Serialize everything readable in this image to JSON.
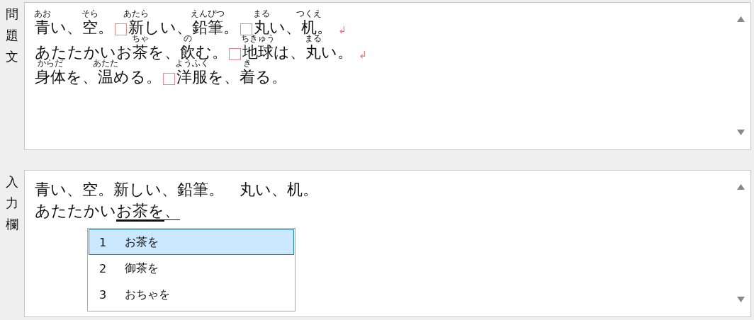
{
  "problem": {
    "label": "問題文",
    "lines": [
      [
        {
          "kind": "ruby",
          "base": "青",
          "ruby": "あお"
        },
        {
          "kind": "text",
          "text": "い、"
        },
        {
          "kind": "ruby",
          "base": "空",
          "ruby": "そら"
        },
        {
          "kind": "text",
          "text": "。"
        },
        {
          "kind": "blank"
        },
        {
          "kind": "ruby",
          "base": "新",
          "ruby": "あたら"
        },
        {
          "kind": "text",
          "text": "しい、"
        },
        {
          "kind": "ruby",
          "base": "鉛筆",
          "ruby": "えんぴつ"
        },
        {
          "kind": "text",
          "text": "。"
        },
        {
          "kind": "blank"
        },
        {
          "kind": "ruby",
          "base": "丸",
          "ruby": "まる"
        },
        {
          "kind": "text",
          "text": "い、"
        },
        {
          "kind": "ruby",
          "base": "机",
          "ruby": "つくえ"
        },
        {
          "kind": "text",
          "text": "。"
        },
        {
          "kind": "return",
          "text": "↲"
        }
      ],
      [
        {
          "kind": "text",
          "text": "あたたかいお"
        },
        {
          "kind": "ruby",
          "base": "茶",
          "ruby": "ちゃ"
        },
        {
          "kind": "text",
          "text": "を、"
        },
        {
          "kind": "ruby",
          "base": "飲",
          "ruby": "の"
        },
        {
          "kind": "text",
          "text": "む。"
        },
        {
          "kind": "blank"
        },
        {
          "kind": "ruby",
          "base": "地球",
          "ruby": "ちきゅう"
        },
        {
          "kind": "text",
          "text": "は、"
        },
        {
          "kind": "ruby",
          "base": "丸",
          "ruby": "まる"
        },
        {
          "kind": "text",
          "text": "い。"
        },
        {
          "kind": "return",
          "text": "↲"
        }
      ],
      [
        {
          "kind": "ruby",
          "base": "身体",
          "ruby": "からだ"
        },
        {
          "kind": "text",
          "text": "を、"
        },
        {
          "kind": "ruby",
          "base": "温",
          "ruby": "あたた"
        },
        {
          "kind": "text",
          "text": "める。"
        },
        {
          "kind": "blank"
        },
        {
          "kind": "ruby",
          "base": "洋服",
          "ruby": "ようふく"
        },
        {
          "kind": "text",
          "text": "を、"
        },
        {
          "kind": "ruby",
          "base": "着",
          "ruby": "き"
        },
        {
          "kind": "text",
          "text": "る。"
        }
      ]
    ]
  },
  "input": {
    "label": "入力欄",
    "lines": [
      [
        {
          "kind": "typed",
          "text": "青い、空。新しい、鉛筆。　丸い、机。"
        }
      ],
      [
        {
          "kind": "typed",
          "text": "あたたかい"
        },
        {
          "kind": "composing",
          "text": "お茶を"
        },
        {
          "kind": "pending",
          "text": "、"
        }
      ]
    ],
    "candidates": [
      {
        "number": "1",
        "text": "お茶を",
        "selected": true
      },
      {
        "number": "2",
        "text": "御茶を",
        "selected": false
      },
      {
        "number": "3",
        "text": "おちゃを",
        "selected": false
      }
    ]
  }
}
